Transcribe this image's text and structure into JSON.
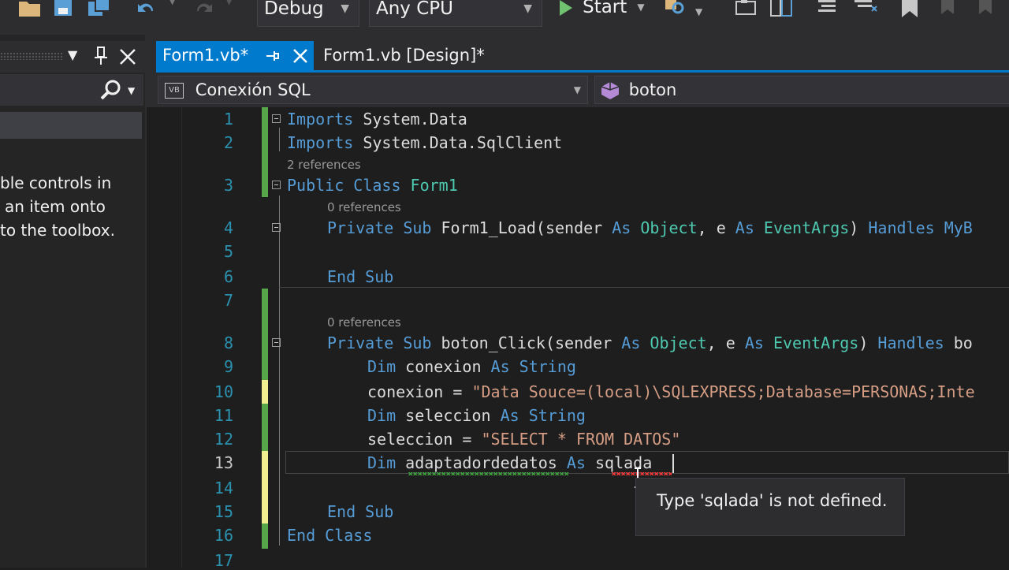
{
  "toolbar": {
    "config": "Debug",
    "platform": "Any CPU",
    "start_label": "Start"
  },
  "toolbox": {
    "empty_message": [
      "ble controls in",
      "an item onto",
      "to the toolbox."
    ]
  },
  "tabs": [
    {
      "label": "Form1.vb*",
      "active": true
    },
    {
      "label": "Form1.vb [Design]*",
      "active": false
    }
  ],
  "navbar": {
    "project": "Conexión SQL",
    "project_badge": "VB",
    "member": "boton"
  },
  "editor": {
    "line_numbers": [
      "1",
      "2",
      "3",
      "4",
      "5",
      "6",
      "7",
      "8",
      "9",
      "10",
      "11",
      "12",
      "13",
      "14",
      "15",
      "16",
      "17"
    ],
    "references": {
      "class_refs": "2 references",
      "load_refs": "0 references",
      "click_refs": "0 references"
    },
    "lines": {
      "l1": [
        {
          "t": "Imports",
          "c": "kw"
        },
        {
          "t": " System.Data",
          "c": ""
        }
      ],
      "l2": [
        {
          "t": "Imports",
          "c": "kw"
        },
        {
          "t": " System.Data.SqlClient",
          "c": ""
        }
      ],
      "l3": [
        {
          "t": "Public Class ",
          "c": "kw"
        },
        {
          "t": "Form1",
          "c": "ty"
        }
      ],
      "l4": [
        {
          "t": "Private Sub ",
          "c": "kw"
        },
        {
          "t": "Form1_Load(sender ",
          "c": ""
        },
        {
          "t": "As ",
          "c": "kw"
        },
        {
          "t": "Object",
          "c": "ty"
        },
        {
          "t": ", e ",
          "c": ""
        },
        {
          "t": "As ",
          "c": "kw"
        },
        {
          "t": "EventArgs",
          "c": "ty"
        },
        {
          "t": ") ",
          "c": ""
        },
        {
          "t": "Handles ",
          "c": "kw"
        },
        {
          "t": "MyB",
          "c": "kw"
        }
      ],
      "l6": [
        {
          "t": "End Sub",
          "c": "kw"
        }
      ],
      "l8": [
        {
          "t": "Private Sub ",
          "c": "kw"
        },
        {
          "t": "boton_Click(sender ",
          "c": ""
        },
        {
          "t": "As ",
          "c": "kw"
        },
        {
          "t": "Object",
          "c": "ty"
        },
        {
          "t": ", e ",
          "c": ""
        },
        {
          "t": "As ",
          "c": "kw"
        },
        {
          "t": "EventArgs",
          "c": "ty"
        },
        {
          "t": ") ",
          "c": ""
        },
        {
          "t": "Handles ",
          "c": "kw"
        },
        {
          "t": "bo",
          "c": ""
        }
      ],
      "l9": [
        {
          "t": "Dim ",
          "c": "kw"
        },
        {
          "t": "conexion ",
          "c": ""
        },
        {
          "t": "As ",
          "c": "kw"
        },
        {
          "t": "String",
          "c": "kw"
        }
      ],
      "l10": [
        {
          "t": "conexion = ",
          "c": ""
        },
        {
          "t": "\"Data Souce=(local)\\SQLEXPRESS;Database=PERSONAS;Inte",
          "c": "st"
        }
      ],
      "l11": [
        {
          "t": "Dim ",
          "c": "kw"
        },
        {
          "t": "seleccion ",
          "c": ""
        },
        {
          "t": "As ",
          "c": "kw"
        },
        {
          "t": "String",
          "c": "kw"
        }
      ],
      "l12": [
        {
          "t": "seleccion = ",
          "c": ""
        },
        {
          "t": "\"SELECT * FROM DATOS\"",
          "c": "st"
        }
      ],
      "l13": [
        {
          "t": "Dim ",
          "c": "kw"
        },
        {
          "t": "adaptadordedatos",
          "c": ""
        },
        {
          "t": " As ",
          "c": "kw"
        },
        {
          "t": "sqlada",
          "c": ""
        }
      ],
      "l15": [
        {
          "t": "End Sub",
          "c": "kw"
        }
      ],
      "l16": [
        {
          "t": "End Class",
          "c": "kw"
        }
      ]
    }
  },
  "tooltip": {
    "message": "Type 'sqlada' is not defined."
  },
  "colors": {
    "accent": "#007acc",
    "keyword": "#569cd6",
    "type": "#4ec9b0",
    "string": "#d69d85",
    "line_number": "#2b91af",
    "saved_change": "#57a64a",
    "unsaved_change": "#efef8f"
  }
}
